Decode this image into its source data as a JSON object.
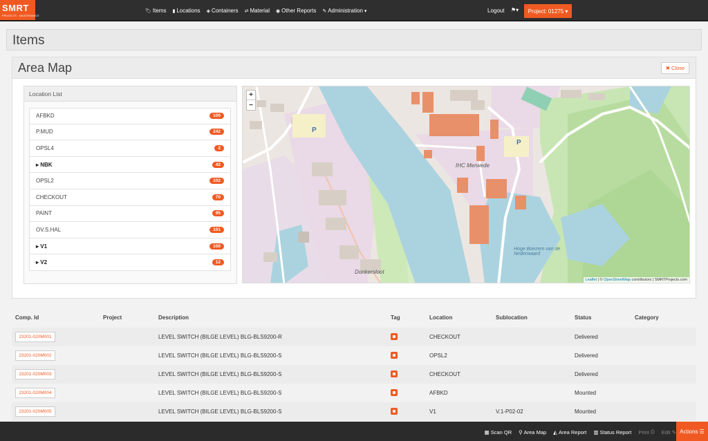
{
  "brand": {
    "name": "SMRT",
    "tagline": "PROJECTS · MAINTENANCE"
  },
  "nav": {
    "items": [
      {
        "label": "Items",
        "icon": "tag-icon"
      },
      {
        "label": "Locations",
        "icon": "building-icon"
      },
      {
        "label": "Containers",
        "icon": "cube-icon"
      },
      {
        "label": "Material",
        "icon": "exchange-icon"
      },
      {
        "label": "Other Reports",
        "icon": "circle-icon"
      },
      {
        "label": "Administration",
        "icon": "wrench-icon"
      }
    ],
    "logout": "Logout",
    "project": "Project: 01275"
  },
  "page": {
    "title": "Items"
  },
  "area_map": {
    "title": "Area Map",
    "close_label": "Close",
    "location_list_title": "Location List",
    "locations": [
      {
        "name": "AFBKD",
        "count": "100",
        "expandable": false
      },
      {
        "name": "P.MUD",
        "count": "242",
        "expandable": false
      },
      {
        "name": "OPSL4",
        "count": "2",
        "expandable": false
      },
      {
        "name": "NBK",
        "count": "42",
        "expandable": true
      },
      {
        "name": "OPSL2",
        "count": "102",
        "expandable": false
      },
      {
        "name": "CHECKOUT",
        "count": "70",
        "expandable": false
      },
      {
        "name": "PAINT",
        "count": "95",
        "expandable": false
      },
      {
        "name": "OV.S.HAL",
        "count": "101",
        "expandable": false
      },
      {
        "name": "V1",
        "count": "100",
        "expandable": true
      },
      {
        "name": "V2",
        "count": "12",
        "expandable": true
      }
    ],
    "map": {
      "zoom_in": "+",
      "zoom_out": "−",
      "labels": {
        "shipyard": "IHC Merwede",
        "channel": "Donkersloot",
        "park": "Hoge Boezem van de Nederwaard",
        "parking1": "P",
        "parking2": "P"
      },
      "attribution": {
        "leaflet": "Leaflet",
        "sep": " | © ",
        "osm": "OpenStreetMap",
        "rest": " contributors | SMRTProjects.com"
      }
    }
  },
  "table": {
    "headers": [
      "Comp. Id",
      "Project",
      "Description",
      "Tag",
      "Location",
      "Sublocation",
      "Status",
      "Category"
    ],
    "rows": [
      {
        "comp_id": "23201-020M001",
        "project": "",
        "description": "LEVEL SWITCH (BILGE LEVEL) BLG-BLS9200-R",
        "location": "CHECKOUT",
        "sublocation": "",
        "status": "Delivered",
        "category": ""
      },
      {
        "comp_id": "23201-020M002",
        "project": "",
        "description": "LEVEL SWITCH (BILGE LEVEL) BLG-BLS9200-S",
        "location": "OPSL2",
        "sublocation": "",
        "status": "Delivered",
        "category": ""
      },
      {
        "comp_id": "23201-020M003",
        "project": "",
        "description": "LEVEL SWITCH (BILGE LEVEL) BLG-BLS9200-S",
        "location": "CHECKOUT",
        "sublocation": "",
        "status": "Delivered",
        "category": ""
      },
      {
        "comp_id": "23201-020M004",
        "project": "",
        "description": "LEVEL SWITCH (BILGE LEVEL) BLG-BLS9200-S",
        "location": "AFBKD",
        "sublocation": "",
        "status": "Mounted",
        "category": ""
      },
      {
        "comp_id": "23201-020M005",
        "project": "",
        "description": "LEVEL SWITCH (BILGE LEVEL) BLG-BLS9200-S",
        "location": "V1",
        "sublocation": "V.1-P02-02",
        "status": "Mounted",
        "category": ""
      }
    ]
  },
  "bottom_bar": {
    "scan_qr": "Scan QR",
    "area_map": "Area Map",
    "area_report": "Area Report",
    "status_report": "Status Report",
    "print": "Print",
    "edit": "Edit",
    "actions": "Actions"
  },
  "colors": {
    "accent": "#f05a22",
    "navbar": "#2f2f2f",
    "water": "#aad3df",
    "building": "#e8906a"
  }
}
